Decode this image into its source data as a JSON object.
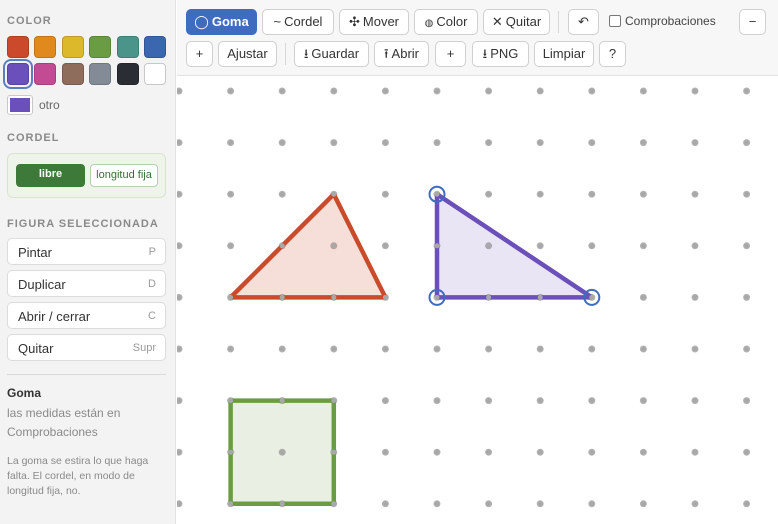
{
  "sidebar": {
    "color_title": "COLOR",
    "colors": [
      "#cc4a2c",
      "#e08a1e",
      "#dcb92a",
      "#6a9c44",
      "#4a9489",
      "#3b66b0",
      "#6b4fbb",
      "#c24b93",
      "#8f6d5c",
      "#838b97",
      "#2a2d33",
      "#ffffff"
    ],
    "selected_color": "#6b4fbb",
    "custom_label": "otro",
    "cord_title": "CORDEL",
    "cord_modes": [
      "libre",
      "longitud fija"
    ],
    "figure_title": "FIGURA SELECCIONADA",
    "actions": [
      {
        "label": "Pintar",
        "key": "P"
      },
      {
        "label": "Duplicar",
        "key": "D"
      },
      {
        "label": "Abrir / cerrar",
        "key": "C"
      },
      {
        "label": "Quitar",
        "key": "Supr"
      }
    ],
    "info_title": "Goma",
    "info_text": "las medidas están en Comprobaciones",
    "info_note": "La goma se estira lo que haga falta. El cordel, en modo de longitud fija, no."
  },
  "toolbar": {
    "goma": "Goma",
    "cordel": "Cordel",
    "mover": "Mover",
    "color": "Color",
    "quitar": "Quitar",
    "undo": "↶",
    "checks_label": "Comprobaciones",
    "minus": "−",
    "plus": "+",
    "ajustar": "Ajustar",
    "guardar": "Guardar",
    "abrir": "Abrir",
    "plus2": "+",
    "png": "PNG",
    "limpiar": "Limpiar",
    "help": "?"
  },
  "board": {
    "grid_cols": 12,
    "grid_rows": 9,
    "shapes": [
      {
        "name": "triangle-red",
        "color": "#cc4a2c",
        "fill": "rgba(204,74,44,0.18)",
        "points": [
          [
            1,
            4
          ],
          [
            3,
            2
          ],
          [
            4,
            4
          ]
        ],
        "selected": false
      },
      {
        "name": "triangle-purple",
        "color": "#6b4fbb",
        "fill": "rgba(107,79,187,0.15)",
        "points": [
          [
            5,
            2
          ],
          [
            5,
            4
          ],
          [
            8,
            4
          ]
        ],
        "selected": true
      },
      {
        "name": "square-green",
        "color": "#6a9c44",
        "fill": "rgba(106,156,68,0.15)",
        "points": [
          [
            1,
            6
          ],
          [
            3,
            6
          ],
          [
            3,
            8
          ],
          [
            1,
            8
          ]
        ],
        "selected": false
      }
    ]
  }
}
